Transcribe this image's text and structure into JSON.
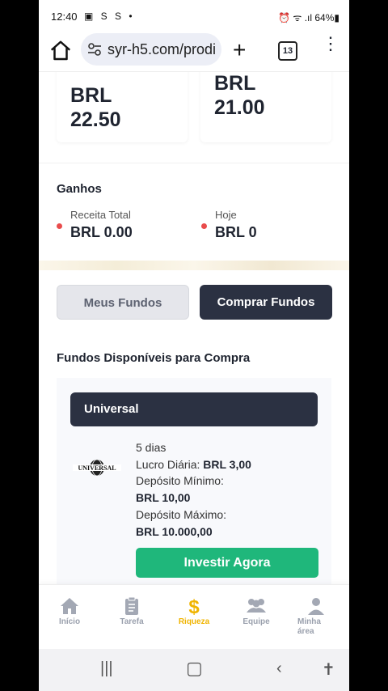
{
  "status_bar": {
    "time": "12:40",
    "notification_icons": "▣ S S •",
    "right_text": "⏰ ᯤ .ıl 64%▮"
  },
  "browser": {
    "url": "syr-h5.com/prodi",
    "tab_count": "13"
  },
  "top_values": {
    "left_value_line1": "BRL",
    "left_value_line2": "22.50",
    "right_value_line1": "BRL",
    "right_value_line2": "21.00"
  },
  "earnings": {
    "title": "Ganhos",
    "total_label": "Receita Total",
    "total_value": "BRL 0.00",
    "today_label": "Hoje",
    "today_value": "BRL 0"
  },
  "tabs": {
    "my_funds": "Meus Fundos",
    "buy_funds": "Comprar Fundos"
  },
  "available": {
    "title": "Fundos Disponíveis para Compra"
  },
  "fund": {
    "name": "Universal",
    "logo_text": "UNIVERSAL",
    "duration": "5 dias",
    "daily_profit_label": "Lucro Diária:",
    "daily_profit_value": "BRL 3,00",
    "min_deposit_label": "Depósito Mínimo:",
    "min_deposit_value": "BRL 10,00",
    "max_deposit_label": "Depósito Máximo:",
    "max_deposit_value": "BRL 10.000,00",
    "invest_button": "Investir Agora"
  },
  "bottom_nav": {
    "items": [
      {
        "label": "Início",
        "icon": "home-icon"
      },
      {
        "label": "Tarefa",
        "icon": "clipboard-icon"
      },
      {
        "label": "Riqueza",
        "icon": "dollar-icon"
      },
      {
        "label": "Equipe",
        "icon": "team-icon"
      },
      {
        "label": "Minha área",
        "icon": "user-icon"
      }
    ]
  },
  "colors": {
    "accent": "#f0b400",
    "dark": "#2b3142",
    "green": "#1fb77b",
    "dot": "#e94c4c"
  }
}
